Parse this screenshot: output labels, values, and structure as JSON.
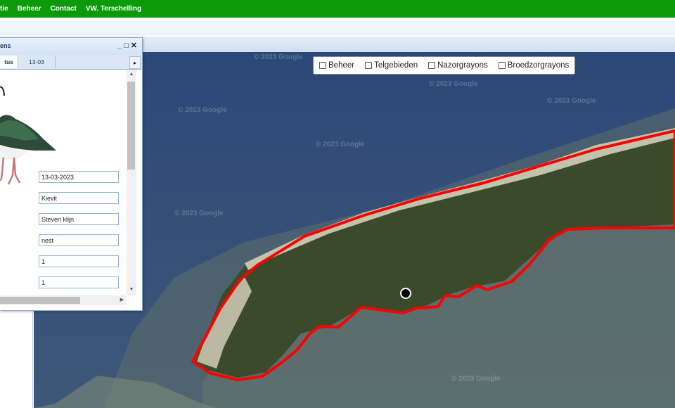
{
  "nav": {
    "items": [
      "tie",
      "Beheer",
      "Contact",
      "VW. Terschelling"
    ]
  },
  "window": {
    "title": "ens",
    "minimize": "_",
    "maximize": "□",
    "close": "✕",
    "tabs": [
      "tus",
      "13-03"
    ],
    "tab_more": "▸",
    "fields": [
      "13-03-2023",
      "Kievit",
      "Steven  klijn",
      "nest",
      "1",
      "1"
    ]
  },
  "layers": {
    "options": [
      "Beheer",
      "Telgebieden",
      "Nazorgrayons",
      "Broedzorgrayons"
    ]
  },
  "map": {
    "watermark": "© 2023 Google",
    "boundary_color": "#ff0000"
  },
  "icons": {
    "close": "close-icon",
    "minimize": "minimize-icon",
    "maximize": "maximize-icon",
    "marker": "location-marker-icon",
    "bird": "lapwing-bird-icon"
  }
}
